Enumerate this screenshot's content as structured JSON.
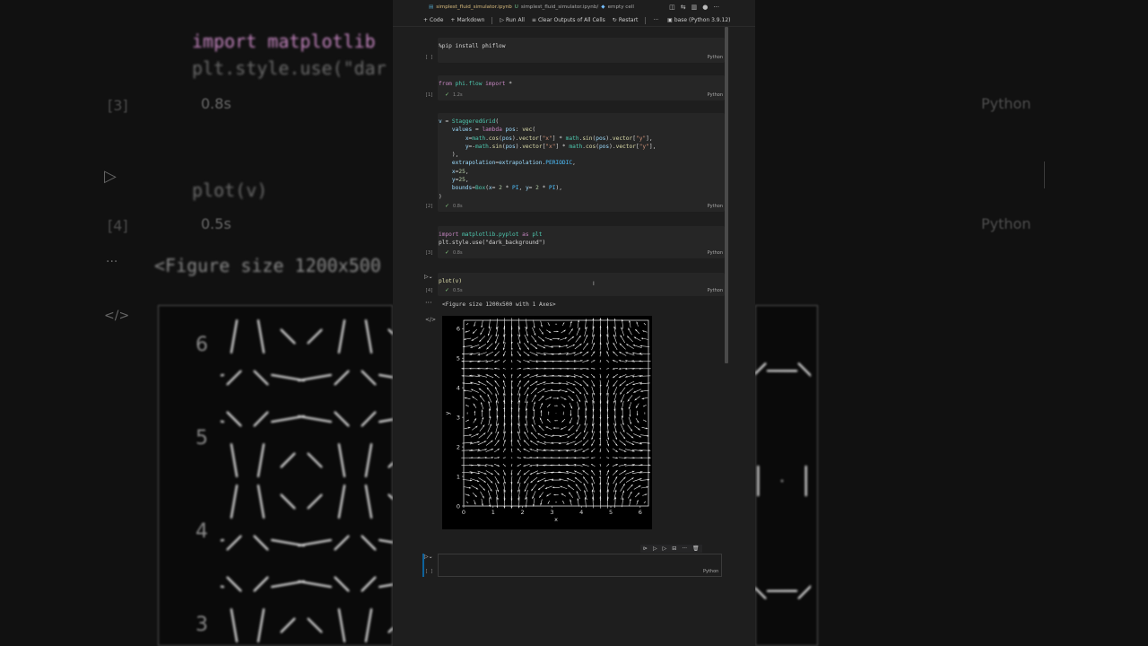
{
  "tabbar": {
    "file": "simplest_fluid_simulator.ipynb",
    "modified": "U",
    "crumb1": "simplest_fluid_simulator.ipynb/",
    "crumb2": "empty cell"
  },
  "toolbar": {
    "code": "Code",
    "markdown": "Markdown",
    "run_all": "Run All",
    "clear": "Clear Outputs of All Cells",
    "restart": "Restart",
    "more": "···",
    "kernel": "base (Python 3.9.12)"
  },
  "cells": [
    {
      "count": "[ ]",
      "time": "",
      "lang": "Python"
    },
    {
      "count": "[1]",
      "time": "1.2s",
      "lang": "Python"
    },
    {
      "count": "[2]",
      "time": "0.8s",
      "lang": "Python"
    },
    {
      "count": "[3]",
      "time": "0.8s",
      "lang": "Python"
    },
    {
      "count": "[4]",
      "time": "0.5s",
      "lang": "Python"
    },
    {
      "count": "[ ]",
      "time": "",
      "lang": "Python"
    }
  ],
  "code": {
    "c0": "%pip install phiflow",
    "c1_a": "from",
    "c1_b": " phi.flow ",
    "c1_c": "import",
    "c1_d": " *",
    "c3_a": "import",
    "c3_b": " matplotlib.pyplot ",
    "c3_c": "as",
    "c3_d": " plt",
    "c3_line2": "plt.style.use(\"dark_background\")",
    "c4": "plot(v)"
  },
  "output": {
    "text": "<Figure size 1200x500 with 1 Axes>",
    "dots": "···"
  },
  "background": {
    "line1": "import matplotlib",
    "line2": "plt.style.use(\"dar",
    "count3": "[3]",
    "time3": "0.8s",
    "python1": "Python",
    "line3": "plot(v)",
    "count4": "[4]",
    "time4": "0.5s",
    "python2": "Python",
    "line4": "<Figure size 1200x500"
  },
  "chart_data": {
    "type": "quiver",
    "xlabel": "x",
    "ylabel": "y",
    "xlim": [
      0,
      6.28
    ],
    "ylim": [
      0,
      6.28
    ],
    "xticks": [
      0,
      1,
      2,
      3,
      4,
      5,
      6
    ],
    "yticks": [
      0,
      1,
      2,
      3,
      4,
      5,
      6
    ],
    "grid_n": 25,
    "field": "u = cos(x)*sin(y), v = -sin(x)*cos(y)",
    "arrow_color": "#e6e6e6"
  }
}
